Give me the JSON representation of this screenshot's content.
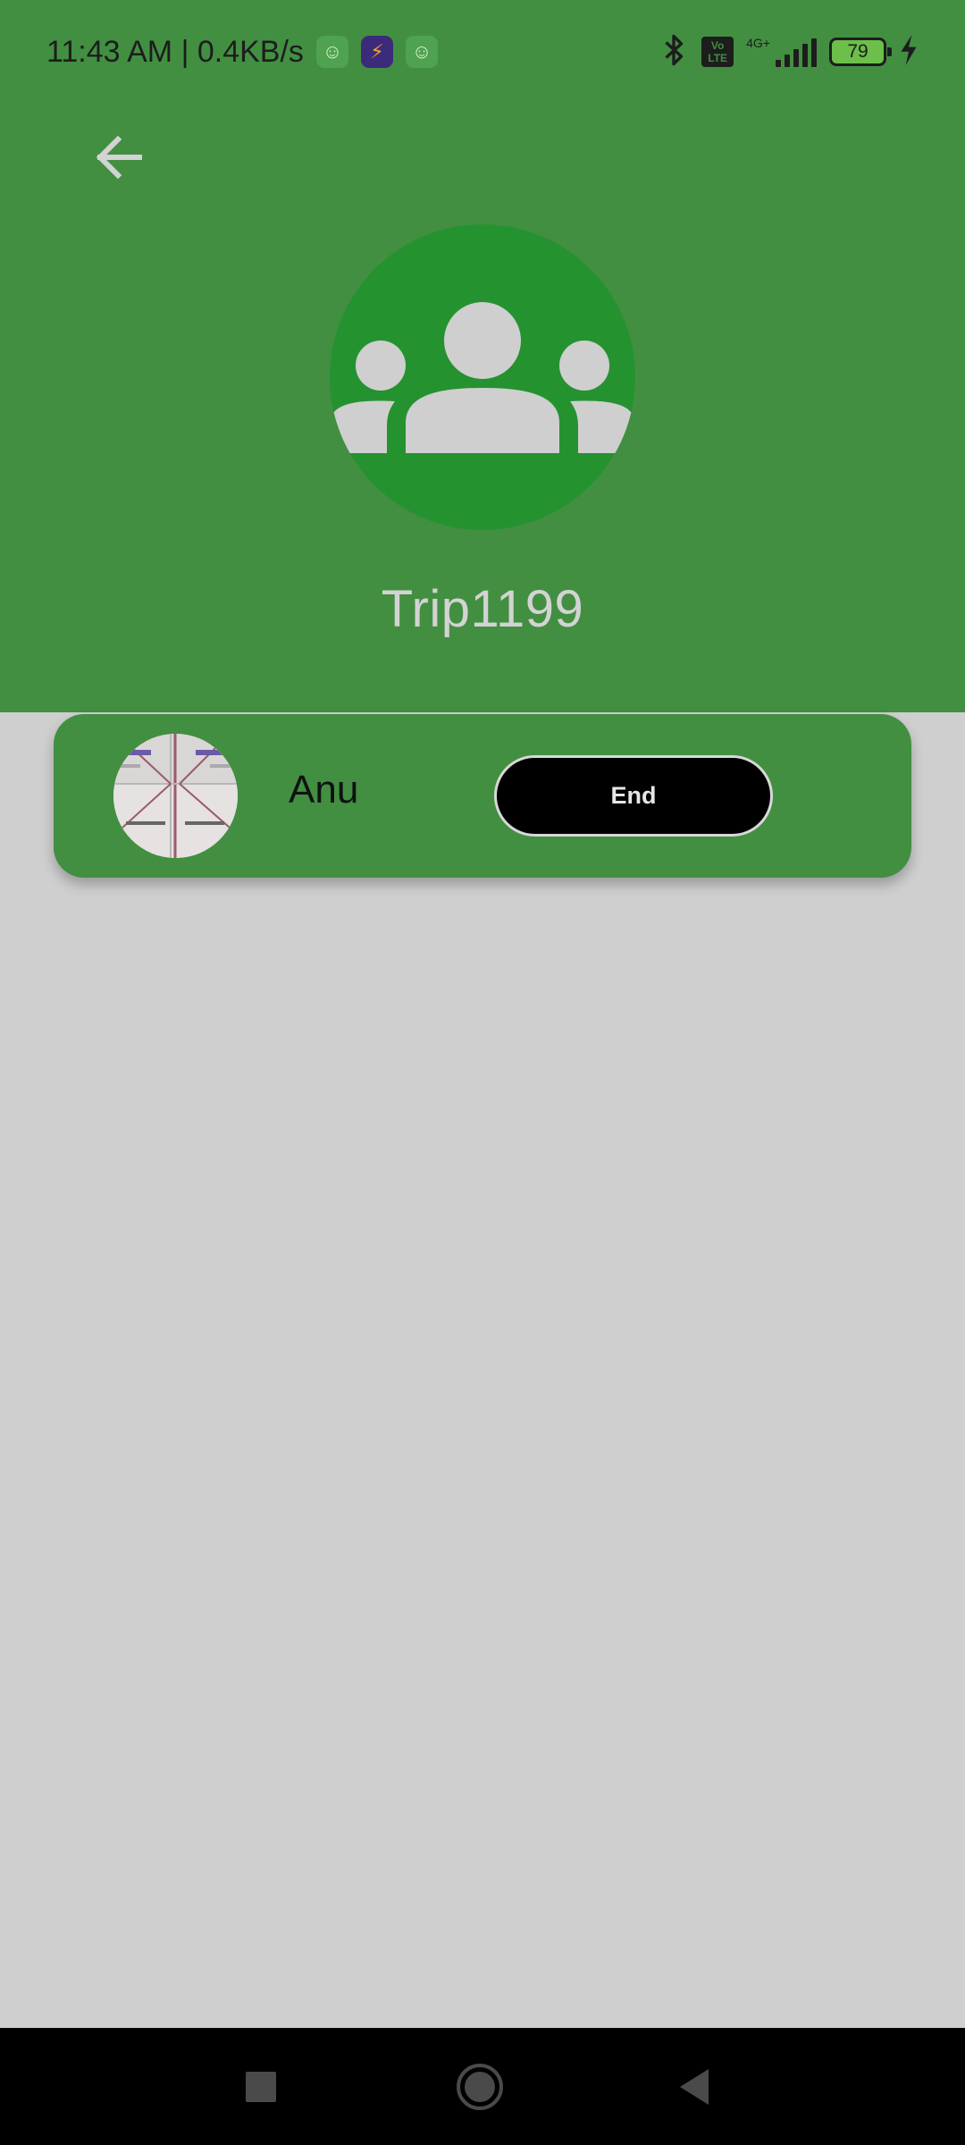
{
  "status_bar": {
    "time_and_speed": "11:43 AM | 0.4KB/s",
    "network_label": "4G+",
    "volte_label": "Vo LTE",
    "battery_level": "79",
    "icons": [
      "cat-app-icon",
      "rocket-app-icon",
      "cat-app-icon",
      "bluetooth-icon",
      "volte-icon",
      "signal-icon",
      "battery-icon",
      "charging-icon"
    ]
  },
  "header": {
    "back_icon": "arrow-left-icon",
    "group_icon": "group-people-icon",
    "title": "Trip1199"
  },
  "members": [
    {
      "name": "Anu",
      "avatar_icon": "member-photo",
      "action_label": "End"
    }
  ],
  "navigation_bar": {
    "icons": [
      "square-recents-icon",
      "circle-home-icon",
      "triangle-back-icon"
    ]
  },
  "colors": {
    "header_green": "#428f42",
    "avatar_green": "#259230",
    "background": "#cfcfcf",
    "end_button": "#000000"
  }
}
